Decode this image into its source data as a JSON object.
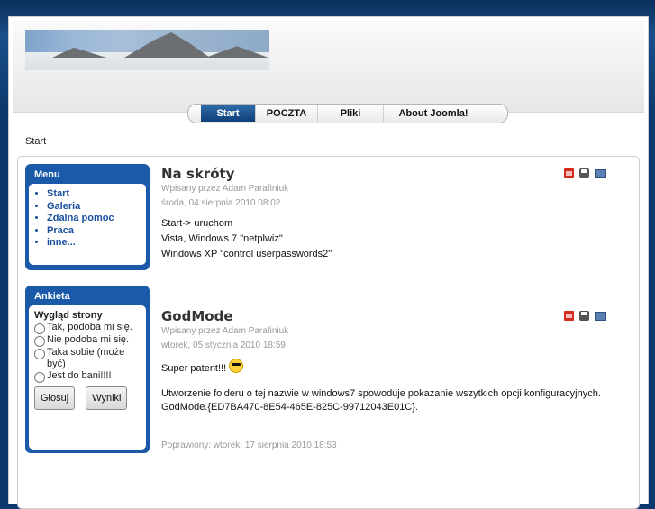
{
  "nav": {
    "items": [
      "Start",
      "POCZTA",
      "Pliki",
      "About Joomla!"
    ],
    "active": "Start"
  },
  "breadcrumb": "Start",
  "menu_module": {
    "title": "Menu",
    "items": [
      "Start",
      "Galeria",
      "Zdalna pomoc",
      "Praca",
      "inne..."
    ]
  },
  "poll_module": {
    "title": "Ankieta",
    "question": "Wygląd strony",
    "options": [
      "Tak, podoba mi się.",
      "Nie podoba mi się.",
      "Taka sobie (może być)",
      "Jest do bani!!!!"
    ],
    "vote_label": "Głosuj",
    "results_label": "Wyniki"
  },
  "articles": [
    {
      "title": "Na skróty",
      "author": "Wpisany przez Adam Parafiniuk",
      "date": "środa, 04 sierpnia 2010 08:02",
      "lines": [
        "Start-> uruchom",
        "Vista, Windows 7 \"netplwiz\"",
        "Windows XP \"control userpasswords2\""
      ]
    },
    {
      "title": "GodMode",
      "author": "Wpisany przez Adam Parafiniuk",
      "date": "wtorek, 05 stycznia 2010 18:59",
      "line1": "Super patent!!!",
      "para": "Utworzenie folderu o tej nazwie w windows7 spowoduje pokazanie wszytkich opcji konfiguracyjnych.",
      "code": "GodMode.{ED7BA470-8E54-465E-825C-99712043E01C}.",
      "modified": "Poprawiony: wtorek, 17 sierpnia 2010 18:53"
    }
  ],
  "icons": [
    "pdf-icon",
    "print-icon",
    "email-icon"
  ]
}
